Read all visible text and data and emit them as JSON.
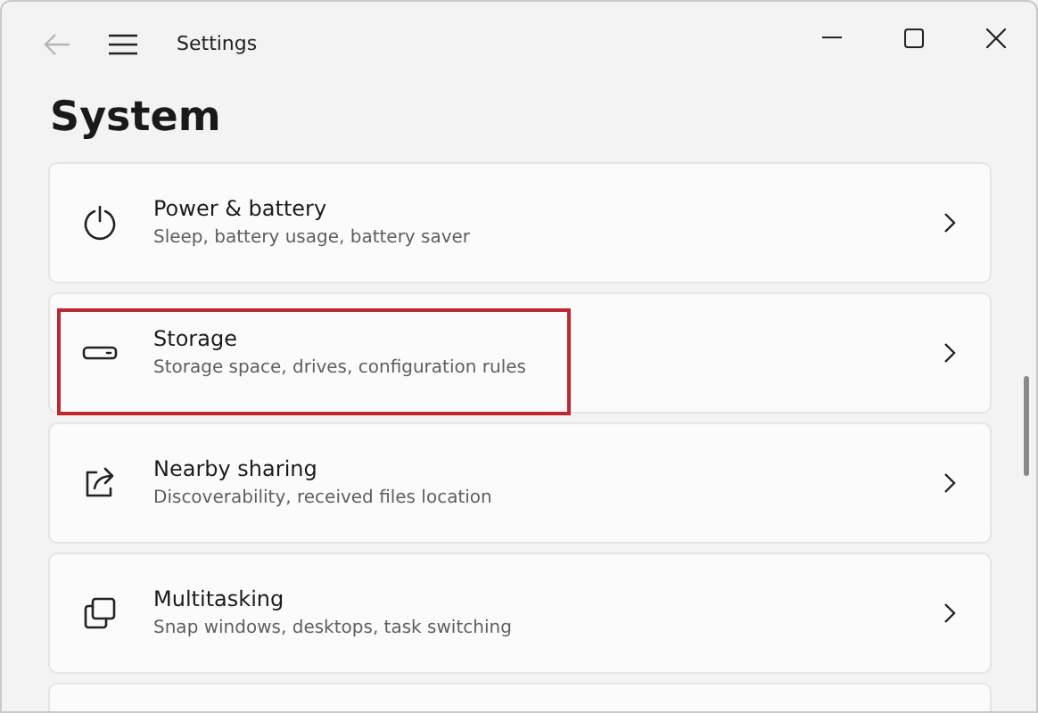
{
  "window": {
    "title": "Settings",
    "back_enabled": false
  },
  "page_title": "System",
  "items": [
    {
      "kind": "power",
      "title": "Power & battery",
      "subtitle": "Sleep, battery usage, battery saver",
      "highlighted": false
    },
    {
      "kind": "drive",
      "title": "Storage",
      "subtitle": "Storage space, drives, configuration rules",
      "highlighted": true
    },
    {
      "kind": "share",
      "title": "Nearby sharing",
      "subtitle": "Discoverability, received files location",
      "highlighted": false
    },
    {
      "kind": "windows",
      "title": "Multitasking",
      "subtitle": "Snap windows, desktops, task switching",
      "highlighted": false
    }
  ]
}
